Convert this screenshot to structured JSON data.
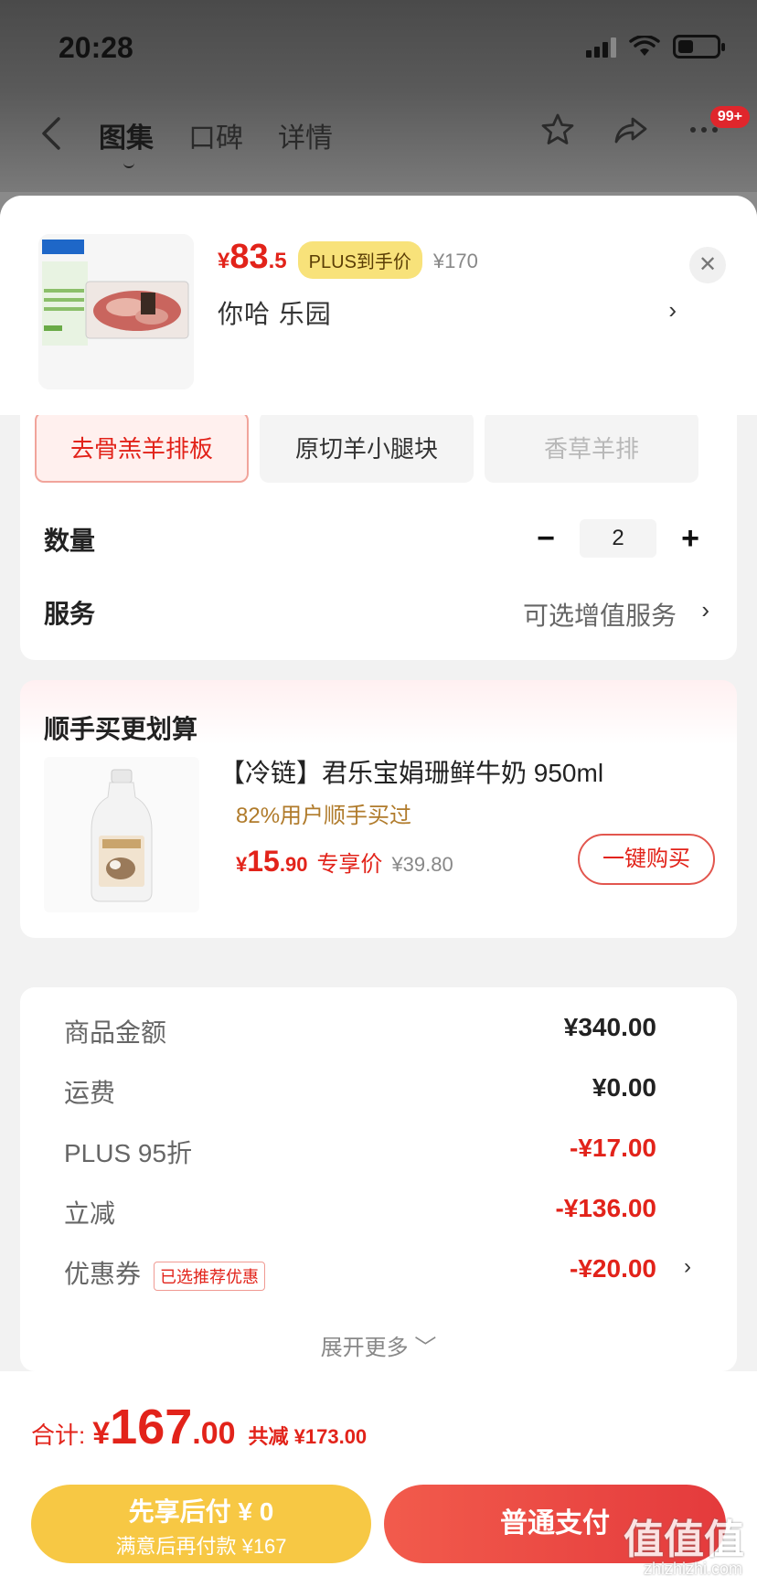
{
  "status_bar": {
    "time": "20:28"
  },
  "nav": {
    "tabs": [
      {
        "label": "图集",
        "active": true
      },
      {
        "label": "口碑",
        "active": false
      },
      {
        "label": "详情",
        "active": false
      }
    ],
    "badge": "99+"
  },
  "product": {
    "price_int": "83",
    "price_dec": ".5",
    "currency": "¥",
    "plus_tag": "PLUS到手价",
    "original_price": "¥170",
    "spec": "你哈  乐园",
    "close": "✕"
  },
  "variants": [
    {
      "label": "去骨羔羊排板",
      "state": "selected"
    },
    {
      "label": "原切羊小腿块",
      "state": "normal"
    },
    {
      "label": "香草羊排",
      "state": "disabled"
    }
  ],
  "quantity": {
    "label": "数量",
    "minus": "−",
    "value": "2",
    "plus": "+"
  },
  "service": {
    "label": "服务",
    "value": "可选增值服务"
  },
  "cross_sell": {
    "title": "顺手买更划算",
    "name": "【冷链】君乐宝娟珊鲜牛奶 950ml",
    "ratio": "82%用户顺手买过",
    "currency": "¥",
    "price_int": "15",
    "price_dec": ".90",
    "price_tag": "专享价",
    "original_price": "¥39.80",
    "button": "一键购买"
  },
  "summary": {
    "rows": [
      {
        "label": "商品金额",
        "value": "¥340.00",
        "tag": ""
      },
      {
        "label": "运费",
        "value": "¥0.00",
        "tag": ""
      },
      {
        "label": "PLUS 95折",
        "value": "-¥17.00",
        "tag": ""
      },
      {
        "label": "立减",
        "value": "-¥136.00",
        "tag": ""
      },
      {
        "label": "优惠券",
        "value": "-¥20.00",
        "tag": "已选推荐优惠"
      }
    ],
    "expand": "展开更多 ﹀"
  },
  "bottom": {
    "total_label": "合计:",
    "currency": "¥",
    "total_int": "167",
    "total_dec": ".00",
    "total_save": "共减 ¥173.00",
    "pay_later_title": "先享后付 ¥ 0",
    "pay_later_sub": "满意后再付款 ¥167",
    "pay_normal": "普通支付"
  },
  "watermark": {
    "main": "值值值",
    "sub": "zhizhizhi.com"
  },
  "colors": {
    "accent_red": "#e2231a",
    "plus_yellow": "#f8e27a",
    "pay_later_yellow": "#f7c844",
    "cross_sell_gold": "#b07b2b"
  }
}
